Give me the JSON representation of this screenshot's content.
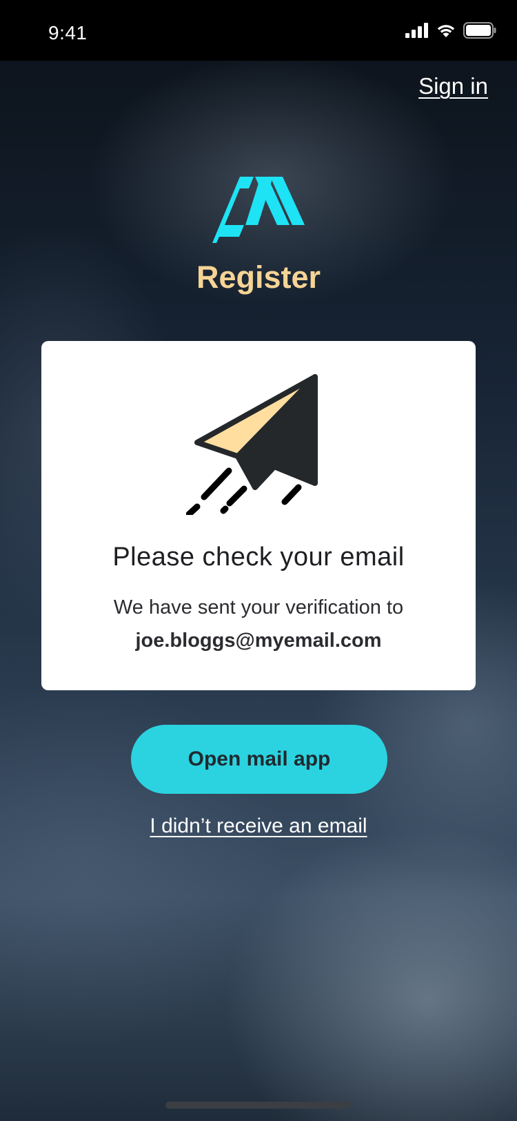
{
  "status_bar": {
    "time": "9:41",
    "icons": [
      "signal-icon",
      "wifi-icon",
      "battery-icon"
    ]
  },
  "header": {
    "sign_in_label": "Sign in",
    "logo_icon": "app-logo-icon",
    "title": "Register"
  },
  "card": {
    "illustration_icon": "paper-plane-icon",
    "heading": "Please check your email",
    "subtext": "We have sent your verification to",
    "email": "joe.bloggs@myemail.com"
  },
  "actions": {
    "open_mail_label": "Open mail app",
    "no_email_label": "I didn’t receive an email"
  },
  "colors": {
    "accent": "#2bd3e0",
    "logo": "#1ee3f5",
    "title": "#f6d495",
    "plane_fill": "#ffdea0",
    "plane_dark": "#25282b"
  }
}
